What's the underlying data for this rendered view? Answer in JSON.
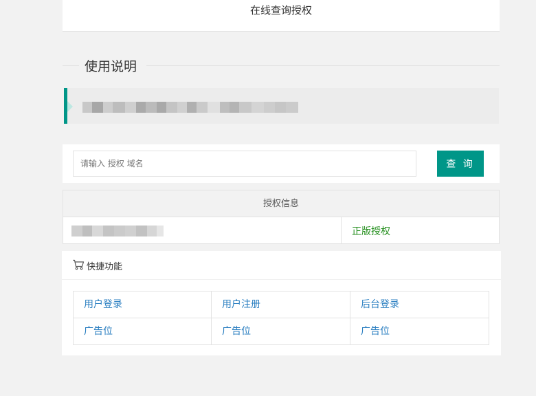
{
  "header": {
    "title": "在线查询授权"
  },
  "section": {
    "title": "使用说明"
  },
  "notice": {
    "text_redacted": true
  },
  "search": {
    "placeholder": "请输入 授权 域名",
    "value": "",
    "button_label": "查 询"
  },
  "info_table": {
    "header": "授权信息",
    "row": {
      "domain_redacted": true,
      "status": "正版授权"
    }
  },
  "quick": {
    "icon": "cart-icon",
    "title": "快捷功能",
    "links": [
      {
        "label": "用户登录"
      },
      {
        "label": "用户注册"
      },
      {
        "label": "后台登录"
      },
      {
        "label": "广告位"
      },
      {
        "label": "广告位"
      },
      {
        "label": "广告位"
      }
    ]
  },
  "colors": {
    "accent": "#009688",
    "link": "#2b7fc1",
    "status_ok": "#238e1c",
    "background": "#f2f2f2"
  }
}
